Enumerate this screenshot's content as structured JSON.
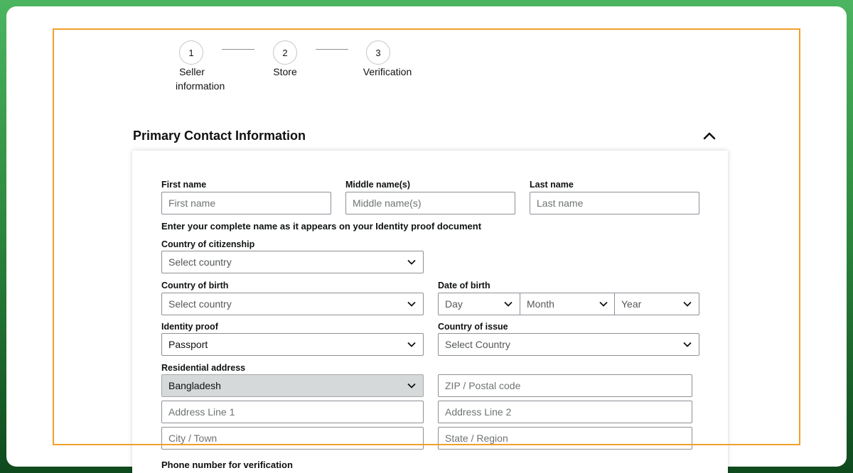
{
  "stepper": {
    "steps": [
      {
        "number": "1",
        "label_line1": "Seller",
        "label_line2": "information"
      },
      {
        "number": "2",
        "label_line1": "Store"
      },
      {
        "number": "3",
        "label_line1": "Verification"
      }
    ]
  },
  "section": {
    "title": "Primary Contact Information",
    "collapse_icon": "chevron-up-icon"
  },
  "form": {
    "first_name": {
      "label": "First name",
      "placeholder": "First name"
    },
    "middle_name": {
      "label": "Middle name(s)",
      "placeholder": "Middle name(s)"
    },
    "last_name": {
      "label": "Last name",
      "placeholder": "Last name"
    },
    "name_note": "Enter your complete name as it appears on your Identity proof document",
    "citizenship": {
      "label": "Country of citizenship",
      "value": "Select country"
    },
    "birth_country": {
      "label": "Country of birth",
      "value": "Select country"
    },
    "date_of_birth": {
      "label": "Date of birth",
      "day": "Day",
      "month": "Month",
      "year": "Year"
    },
    "identity_proof": {
      "label": "Identity proof",
      "value": "Passport"
    },
    "country_of_issue": {
      "label": "Country of issue",
      "value": "Select Country"
    },
    "residential_address": {
      "label": "Residential address",
      "country": "Bangladesh",
      "zip_placeholder": "ZIP / Postal code",
      "address1_placeholder": "Address Line 1",
      "address2_placeholder": "Address Line 2",
      "city_placeholder": "City / Town",
      "state_placeholder": "State / Region"
    },
    "phone_label": "Phone number for verification"
  },
  "colors": {
    "highlight_frame": "#f0a12a",
    "background_gradient_top": "#4cb560",
    "background_gradient_bottom": "#0f4a1e"
  }
}
